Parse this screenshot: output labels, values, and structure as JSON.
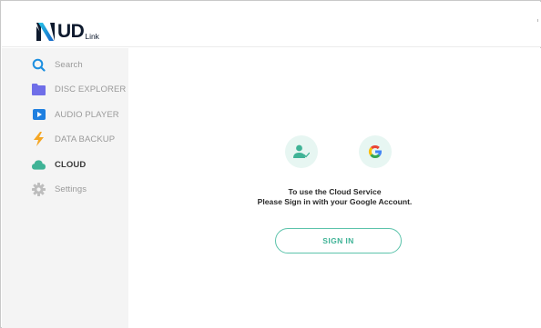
{
  "app": {
    "logo_text": "UD",
    "logo_sub": "Link",
    "accent_color": "#3fb396",
    "brand_color": "#1d8fe0"
  },
  "sidebar": {
    "items": [
      {
        "label": "Search",
        "icon": "search-icon",
        "active": false
      },
      {
        "label": "DISC EXPLORER",
        "icon": "folder-icon",
        "active": false
      },
      {
        "label": "AUDIO PLAYER",
        "icon": "play-icon",
        "active": false
      },
      {
        "label": "DATA BACKUP",
        "icon": "backup-icon",
        "active": false
      },
      {
        "label": "CLOUD",
        "icon": "cloud-icon",
        "active": true
      },
      {
        "label": "Settings",
        "icon": "gear-icon",
        "active": false
      }
    ]
  },
  "main": {
    "icons": [
      "user-check-icon",
      "google-icon"
    ],
    "message_line1": "To use the Cloud Service",
    "message_line2": "Please Sign in with your Google Account.",
    "signin_label": "SIGN IN"
  }
}
